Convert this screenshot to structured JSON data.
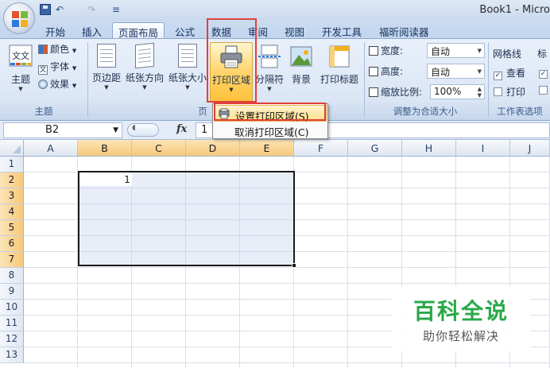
{
  "window": {
    "title": "Book1 - Micro"
  },
  "quick_access": {
    "undo": "↶",
    "redo": "↷",
    "more": "≡"
  },
  "tabs": [
    "开始",
    "插入",
    "页面布局",
    "公式",
    "数据",
    "审阅",
    "视图",
    "开发工具",
    "福昕阅读器"
  ],
  "active_tab": "页面布局",
  "ribbon": {
    "theme_group": {
      "label": "主题",
      "themes_button": "主题",
      "colors": "颜色",
      "fonts": "字体",
      "effects": "效果"
    },
    "page_setup_group": {
      "label": "页",
      "margins": "页边距",
      "orientation": "纸张方向",
      "size": "纸张大小",
      "print_area": "打印区域",
      "breaks": "分隔符",
      "background": "背景",
      "print_titles": "打印标题"
    },
    "scale_group": {
      "label": "调整为合适大小",
      "width_label": "宽度:",
      "width_value": "自动",
      "height_label": "高度:",
      "height_value": "自动",
      "scale_label": "缩放比例:",
      "scale_value": "100%"
    },
    "sheet_options_group": {
      "label": "工作表选项",
      "gridlines": "网格线",
      "view": "查看",
      "print": "打印",
      "headings_partial": "标"
    }
  },
  "print_area_menu": {
    "set": "设置打印区域(S)",
    "clear": "取消打印区域(C)"
  },
  "formula_bar": {
    "name_box": "B2",
    "fx": "fx",
    "content": "1"
  },
  "sheet": {
    "columns": [
      "A",
      "B",
      "C",
      "D",
      "E",
      "F",
      "G",
      "H",
      "I",
      "J"
    ],
    "rows": [
      "1",
      "2",
      "3",
      "4",
      "5",
      "6",
      "7",
      "8",
      "9",
      "10",
      "11",
      "12",
      "13"
    ],
    "selected_range": "B2:E7",
    "b2_value": "1"
  },
  "watermark": {
    "title": "百科全说",
    "subtitle": "助你轻松解决"
  },
  "colors": {
    "highlight_red": "#e0413b",
    "selection_header": "#f8c87b",
    "watermark_green": "#2aa84a"
  }
}
